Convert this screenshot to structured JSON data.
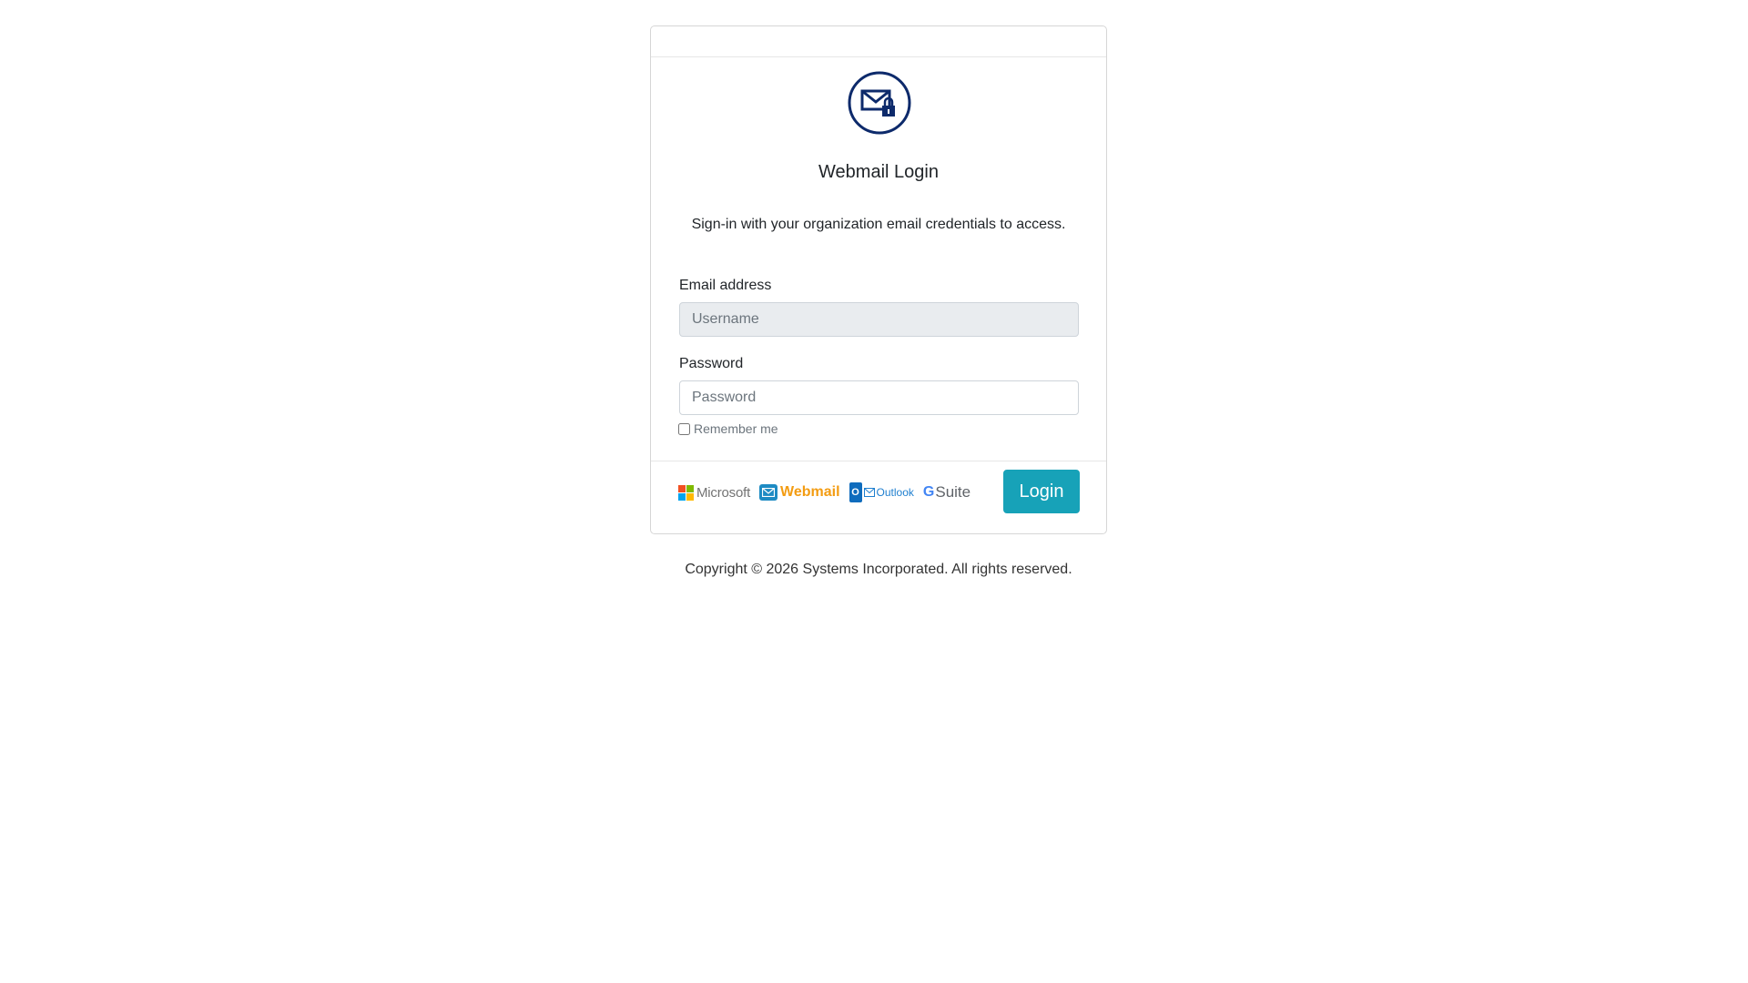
{
  "login": {
    "title": "Webmail Login",
    "subtitle": "Sign-in with your organization email credentials to access.",
    "email_label": "Email address",
    "email_placeholder": "Username",
    "password_label": "Password",
    "password_placeholder": "Password",
    "remember_label": "Remember me",
    "login_button": "Login",
    "accent_color": "#17a2b8",
    "logo_color": "#0d2a6b"
  },
  "brands": {
    "microsoft": "Microsoft",
    "webmail": "Webmail",
    "outlook_letter": "O",
    "outlook": "Outlook",
    "gsuite_letter": "G",
    "gsuite": "Suite"
  },
  "footer": {
    "copyright": "Copyright © 2026 Systems Incorporated. All rights reserved."
  }
}
